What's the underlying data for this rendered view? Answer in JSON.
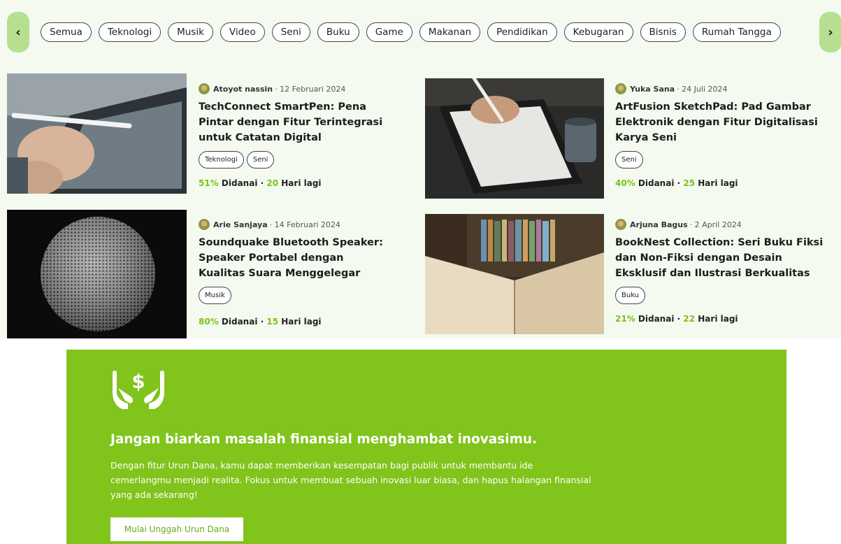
{
  "categories": {
    "prev_icon": "chevron-left-icon",
    "next_icon": "chevron-right-icon",
    "items": [
      "Semua",
      "Teknologi",
      "Musik",
      "Video",
      "Seni",
      "Buku",
      "Game",
      "Makanan",
      "Pendidikan",
      "Kebugaran",
      "Bisnis",
      "Rumah Tangga"
    ]
  },
  "cards": [
    {
      "author": "Atoyot nassin",
      "date": "· 12 Februari 2024",
      "title": "TechConnect SmartPen: Pena Pintar dengan Fitur Terintegrasi untuk Catatan Digital",
      "tags": [
        "Teknologi",
        "Seni"
      ],
      "funded": "51%",
      "funded_label": "Didanai ·",
      "days": "20",
      "days_label": "Hari lagi"
    },
    {
      "author": "Yuka Sana",
      "date": "· 24 Juli 2024",
      "title": "ArtFusion SketchPad: Pad Gambar Elektronik dengan Fitur Digitalisasi Karya Seni",
      "tags": [
        "Seni"
      ],
      "funded": "40%",
      "funded_label": "Didanai ·",
      "days": "25",
      "days_label": "Hari lagi"
    },
    {
      "author": "Arie Sanjaya",
      "date": "· 14 Februari 2024",
      "title": "Soundquake Bluetooth Speaker: Speaker Portabel dengan Kualitas Suara Menggelegar",
      "tags": [
        "Musik"
      ],
      "funded": "80%",
      "funded_label": "Didanai ·",
      "days": "15",
      "days_label": "Hari lagi"
    },
    {
      "author": "Arjuna Bagus",
      "date": "· 2 April 2024",
      "title": "BookNest Collection: Seri Buku Fiksi dan Non-Fiksi dengan Desain Eksklusif dan Ilustrasi Berkualitas",
      "tags": [
        "Buku"
      ],
      "funded": "21%",
      "funded_label": "Didanai ·",
      "days": "22",
      "days_label": "Hari lagi"
    }
  ],
  "banner": {
    "icon": "hand-holding-dollar-icon",
    "title": "Jangan biarkan masalah finansial menghambat inovasimu.",
    "description": "Dengan fitur Urun Dana, kamu dapat memberikan kesempatan bagi publik untuk membantu ide cemerlangmu menjadi realita. Fokus untuk membuat sebuah inovasi luar biasa, dan hapus halangan finansial yang ada sekarang!",
    "button_label": "Mulai Unggah Urun Dana"
  },
  "colors": {
    "accent": "#80c41c",
    "accent_text": "#7bc21a",
    "arrow_bg": "#b6df8f",
    "section_bg": "#f4faf0"
  }
}
